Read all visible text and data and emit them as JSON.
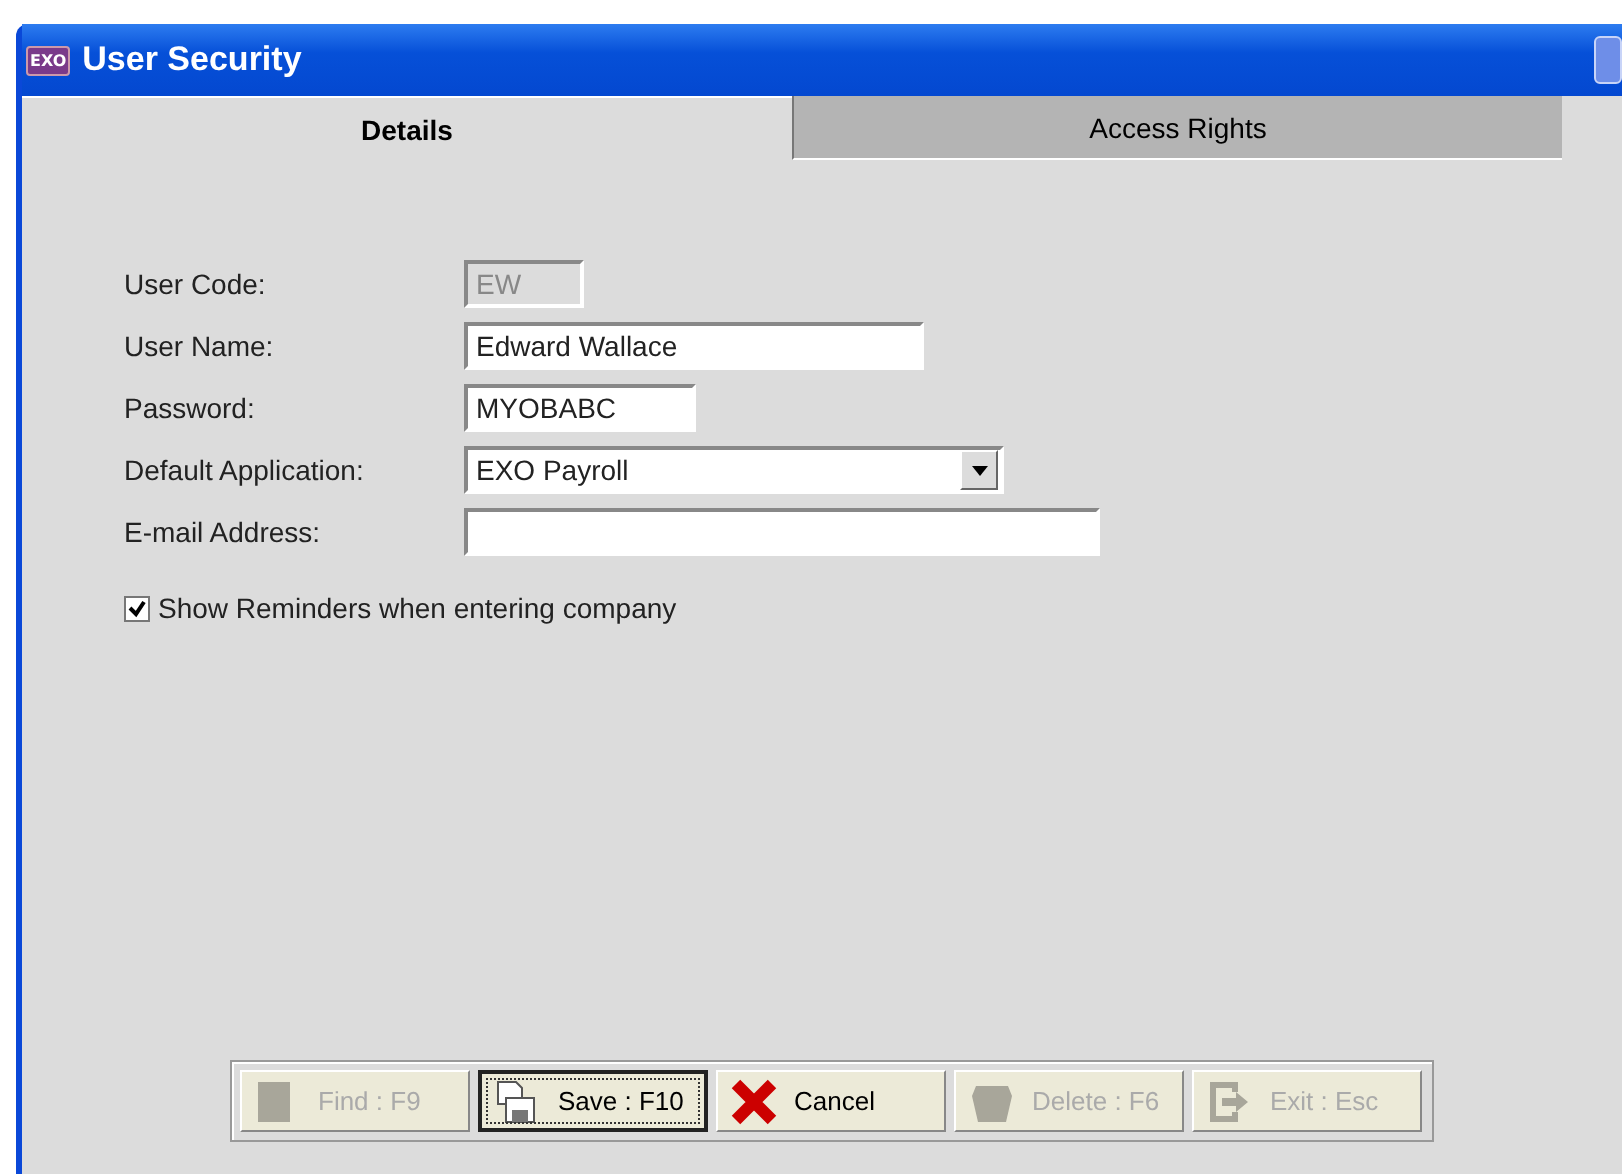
{
  "window": {
    "title": "User Security",
    "app_badge": "EXO"
  },
  "tabs": [
    {
      "label": "Details",
      "selected": true
    },
    {
      "label": "Access Rights",
      "selected": false
    }
  ],
  "fields": [
    {
      "label": "User Code:",
      "kind": "text",
      "value": "EW",
      "disabled": true
    },
    {
      "label": "User Name:",
      "kind": "text",
      "value": "Edward Wallace",
      "disabled": false
    },
    {
      "label": "Password:",
      "kind": "text",
      "value": "MYOBABC",
      "disabled": false
    },
    {
      "label": "Default Application:",
      "kind": "combo",
      "value": "EXO Payroll",
      "disabled": false
    },
    {
      "label": "E-mail Address:",
      "kind": "text",
      "disabled": false
    }
  ],
  "reminder": {
    "label": "Show Reminders when entering company",
    "checked": true
  },
  "buttons": [
    {
      "label": "Find : F9",
      "disabled": true,
      "focused": false
    },
    {
      "label": "Save : F10",
      "disabled": false,
      "focused": true
    },
    {
      "label": "Cancel",
      "disabled": false,
      "focused": false
    },
    {
      "label": "Delete : F6",
      "disabled": true,
      "focused": false
    },
    {
      "label": "Exit : Esc",
      "disabled": true,
      "focused": false
    }
  ]
}
